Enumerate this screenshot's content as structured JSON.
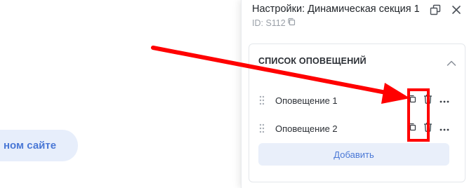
{
  "page": {
    "pill_text": "ном сайте"
  },
  "panel": {
    "title": "Настройки: Динамическая секция 1",
    "id_label": "ID: S112",
    "icons": [
      "restore-window-icon",
      "close-icon"
    ],
    "section": {
      "title": "СПИСОК ОПОВЕЩЕНИЙ",
      "items": [
        {
          "label": "Оповещение 1"
        },
        {
          "label": "Оповещение 2"
        }
      ],
      "add_label": "Добавить"
    }
  },
  "colors": {
    "accent": "#4a78d6",
    "accent_bg": "#e9effa",
    "annotation": "#ff0000"
  }
}
